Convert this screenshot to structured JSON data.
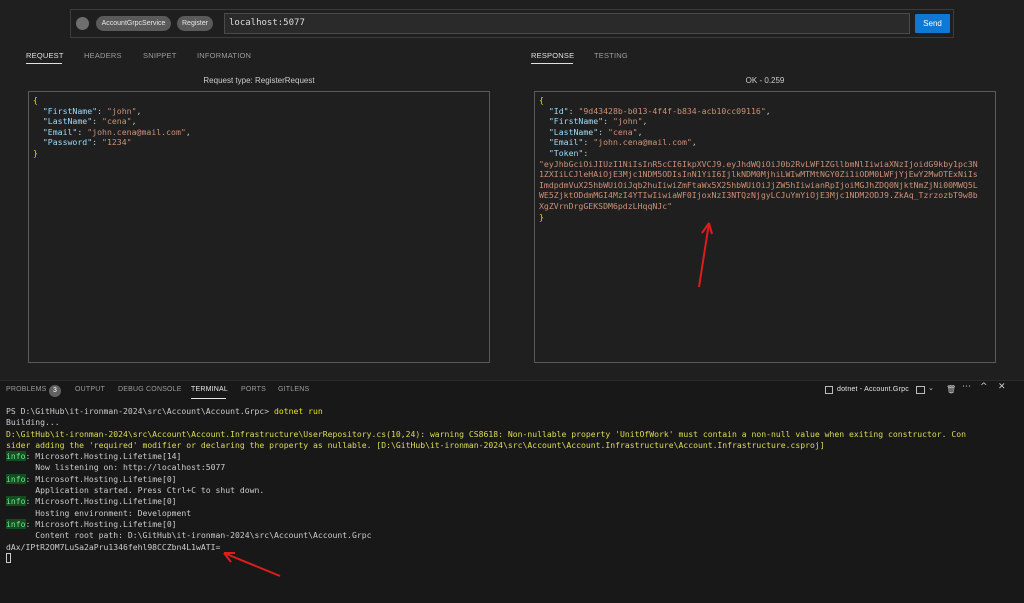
{
  "url_bar": {
    "service_chip": "AccountGrpcService",
    "method_chip": "Register",
    "url_value": "localhost:5077",
    "send_label": "Send"
  },
  "request": {
    "tabs": [
      "REQUEST",
      "HEADERS",
      "SNIPPET",
      "INFORMATION"
    ],
    "type_label": "Request type: RegisterRequest",
    "body": {
      "firstname_key": "\"FirstName\"",
      "firstname_val": "\"john\"",
      "lastname_key": "\"LastName\"",
      "lastname_val": "\"cena\"",
      "email_key": "\"Email\"",
      "email_val": "\"john.cena@mail.com\"",
      "password_key": "\"Password\"",
      "password_val": "\"1234\""
    }
  },
  "response": {
    "tabs": [
      "RESPONSE",
      "TESTING"
    ],
    "status_label": "OK - 0.259",
    "body": {
      "id_key": "\"Id\"",
      "id_val": "\"9d43428b-b013-4f4f-b834-acb10cc09116\"",
      "firstname_key": "\"FirstName\"",
      "firstname_val": "\"john\"",
      "lastname_key": "\"LastName\"",
      "lastname_val": "\"cena\"",
      "email_key": "\"Email\"",
      "email_val": "\"john.cena@mail.com\"",
      "token_key": "\"Token\"",
      "token_lines": [
        "\"eyJhbGciOiJIUzI1NiIsInR5cCI6IkpXVCJ9.eyJhdWQiOiJ0b2RvLWF1ZGllbmNlIiwiaXNzIjoidG9kby1pc3N",
        "1ZXIiLCJleHAiOjE3Mjc1NDM5ODIsInN1YiI6IjlkNDM0MjhiLWIwMTMtNGY0Zi1iODM0LWFjYjEwY2MwOTExNiIs",
        "ImdpdmVuX25hbWUiOiJqb2huIiwiZmFtaWx5X25hbWUiOiJjZW5hIiwianRpIjoiMGJhZDQ0NjktNmZjNi00MWQ5L",
        "WE5ZjktODdmMGI4MzI4YTIwIiwiaWF0IjoxNzI3NTQzNjgyLCJuYmYiOjE3Mjc1NDM2ODJ9.ZkAq_TzrzozbT9w8b",
        "XgZVrnDrgGEKSDM6pdzLHqqNJc\""
      ]
    }
  },
  "panel": {
    "tabs": [
      "PROBLEMS",
      "OUTPUT",
      "DEBUG CONSOLE",
      "TERMINAL",
      "PORTS",
      "GITLENS"
    ],
    "problems_count": "3",
    "terminal_name": "dotnet - Account.Grpc"
  },
  "terminal": {
    "prompt": "PS D:\\GitHub\\it-ironman-2024\\src\\Account\\Account.Grpc> ",
    "command": "dotnet run",
    "building": "Building...",
    "warning_1": "D:\\GitHub\\it-ironman-2024\\src\\Account\\Account.Infrastructure\\UserRepository.cs(10,24): warning CS8618: Non-nullable property 'UnitOfWork' must contain a non-null value when exiting constructor. Con",
    "warning_2": "sider adding the 'required' modifier or declaring the property as nullable. [D:\\GitHub\\it-ironman-2024\\src\\Account\\Account.Infrastructure\\Account.Infrastructure.csproj]",
    "info_label": "info",
    "log_1a": ": Microsoft.Hosting.Lifetime[14]",
    "log_1b": "      Now listening on: http://localhost:5077",
    "log_2a": ": Microsoft.Hosting.Lifetime[0]",
    "log_2b": "      Application started. Press Ctrl+C to shut down.",
    "log_3a": ": Microsoft.Hosting.Lifetime[0]",
    "log_3b": "      Hosting environment: Development",
    "log_4a": ": Microsoft.Hosting.Lifetime[0]",
    "log_4b": "      Content root path: D:\\GitHub\\it-ironman-2024\\src\\Account\\Account.Grpc",
    "secret": "dAx/IPtR2OM7LuSa2aPru1346fehl98CCZbn4L1wATI="
  },
  "colors": {
    "accent": "#0e78d4",
    "annotation_arrow": "#e01b1b"
  }
}
